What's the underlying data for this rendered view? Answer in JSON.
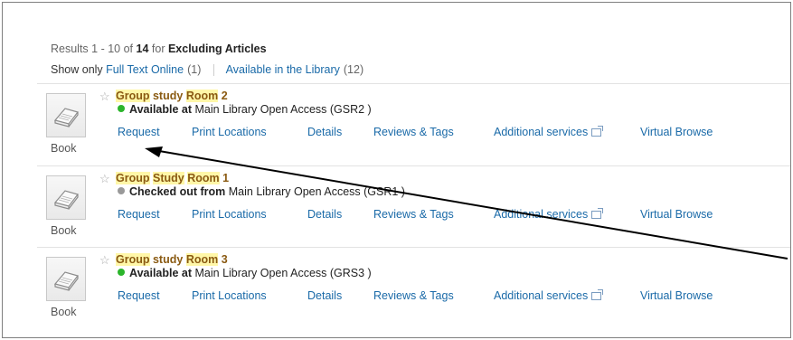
{
  "summary": {
    "prefix": "Results 1 - 10 of",
    "total": "14",
    "for_text": "for",
    "query": "Excluding Articles"
  },
  "filters": {
    "label": "Show only",
    "full_text": {
      "label": "Full Text Online",
      "count": "(1)"
    },
    "in_library": {
      "label": "Available in the Library",
      "count": "(12)"
    }
  },
  "results": [
    {
      "title_parts": [
        "Group",
        "study",
        "Room",
        "2"
      ],
      "status_color": "#2bb52b",
      "status_label": "Available at",
      "location": "Main Library Open Access (GSR2 )",
      "type": "Book"
    },
    {
      "title_parts": [
        "Group",
        "Study",
        "Room",
        "1"
      ],
      "status_color": "#999999",
      "status_label": "Checked out from",
      "location": "Main Library Open Access (GSR1 )",
      "type": "Book"
    },
    {
      "title_parts": [
        "Group",
        "study",
        "Room",
        "3"
      ],
      "status_color": "#2bb52b",
      "status_label": "Available at",
      "location": "Main Library Open Access (GRS3 )",
      "type": "Book"
    }
  ],
  "actions": {
    "request": "Request",
    "print_locations": "Print Locations",
    "details": "Details",
    "reviews": "Reviews & Tags",
    "additional": "Additional services",
    "virtual_browse": "Virtual Browse"
  },
  "icons": {
    "star": "star-outline-icon",
    "book": "book-icon",
    "external": "external-link-icon",
    "availability": "status-dot-icon"
  },
  "colors": {
    "link": "#1a6aa8",
    "title": "#8a5a12",
    "highlight": "#fff7a8",
    "available": "#2bb52b",
    "checked_out": "#999999"
  }
}
